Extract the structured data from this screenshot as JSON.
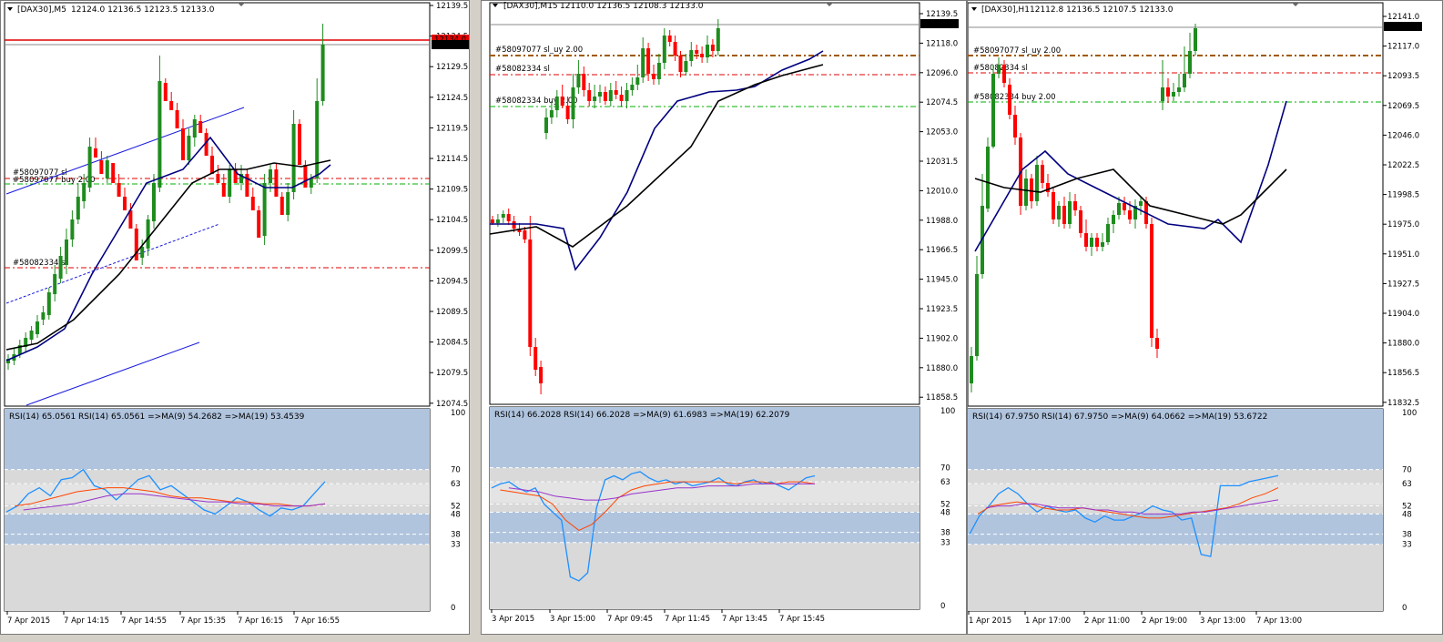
{
  "colors": {
    "bull": "#1e8c1e",
    "bear": "#ff0000",
    "ma_fast": "#000080",
    "ma_slow": "#000000",
    "rsi": "#1e90ff",
    "rsi_ma9": "#ff4500",
    "rsi_ma19": "#9932cc",
    "rsi_zone_blue": "#b0c4de",
    "rsi_zone_grey": "#d9d9d9",
    "stop_line": "#e00000",
    "buy_line": "#00b000",
    "brown_line": "#a05a00",
    "channel": "#1a1adf",
    "price_badge": "#000000"
  },
  "panes": [
    {
      "id": "m5",
      "title": "[DAX30],M5",
      "ohlc": "12124.0 12136.5 12123.5 12133.0",
      "price_badge_red": "12134.0",
      "price_badge": "12133.0",
      "price_labels": [
        "12139.5",
        "12134.5",
        "12129.5",
        "12124.5",
        "12119.5",
        "12114.5",
        "12109.5",
        "12104.5",
        "12099.5",
        "12094.5",
        "12089.5",
        "12084.5",
        "12079.5",
        "12074.5"
      ],
      "order_labels": [
        "#58097077 sl",
        "#58097077 buy 2.00",
        "#58082334 sl"
      ],
      "rsi_header": "RSI(14) 65.0561  RSI(14) 65.0561  =>MA(9) 54.2682  =>MA(19) 53.4539",
      "rsi_levels": [
        "100",
        "70",
        "63",
        "52",
        "48",
        "38",
        "33",
        "0"
      ],
      "time_labels": [
        "7 Apr 2015",
        "7 Apr 14:15",
        "7 Apr 14:55",
        "7 Apr 15:35",
        "7 Apr 16:15",
        "7 Apr 16:55"
      ]
    },
    {
      "id": "m15",
      "title": "[DAX30],M15",
      "ohlc": "12110.0 12136.5 12108.3 12133.0",
      "price_badge": "12133.0",
      "price_labels": [
        "12139.5",
        "12118.0",
        "12096.0",
        "12074.5",
        "12053.0",
        "12031.5",
        "12010.0",
        "11988.0",
        "11966.5",
        "11945.0",
        "11923.5",
        "11902.0",
        "11880.0",
        "11858.5"
      ],
      "order_labels": [
        "#58097077 sl_uy 2.00",
        "#58082334 sl",
        "#58082334 buy 2.00"
      ],
      "rsi_header": "RSI(14) 66.2028  RSI(14) 66.2028  =>MA(9) 61.6983  =>MA(19) 62.2079",
      "rsi_levels": [
        "100",
        "70",
        "63",
        "52",
        "48",
        "38",
        "33",
        "0"
      ],
      "time_labels": [
        "3 Apr 2015",
        "3 Apr 15:00",
        "7 Apr 09:45",
        "7 Apr 11:45",
        "7 Apr 13:45",
        "7 Apr 15:45"
      ]
    },
    {
      "id": "h1",
      "title": "[DAX30],H1",
      "ohlc": "12112.8 12136.5 12107.5 12133.0",
      "price_badge": "12133.0",
      "price_labels": [
        "12141.0",
        "12117.0",
        "12093.5",
        "12069.5",
        "12046.0",
        "12022.5",
        "11998.5",
        "11975.0",
        "11951.0",
        "11927.5",
        "11904.0",
        "11880.0",
        "11856.5",
        "11832.5"
      ],
      "order_labels": [
        "#58097077 sl_uy 2.00",
        "#58082334 sl",
        "#58082334 buy 2.00"
      ],
      "rsi_header": "RSI(14) 67.9750  RSI(14) 67.9750  =>MA(9) 64.0662  =>MA(19) 53.6722",
      "rsi_levels": [
        "100",
        "70",
        "63",
        "52",
        "48",
        "38",
        "33",
        "0"
      ],
      "time_labels": [
        "1 Apr 2015",
        "1 Apr 17:00",
        "2 Apr 11:00",
        "2 Apr 19:00",
        "3 Apr 13:00",
        "7 Apr 13:00"
      ]
    }
  ]
}
